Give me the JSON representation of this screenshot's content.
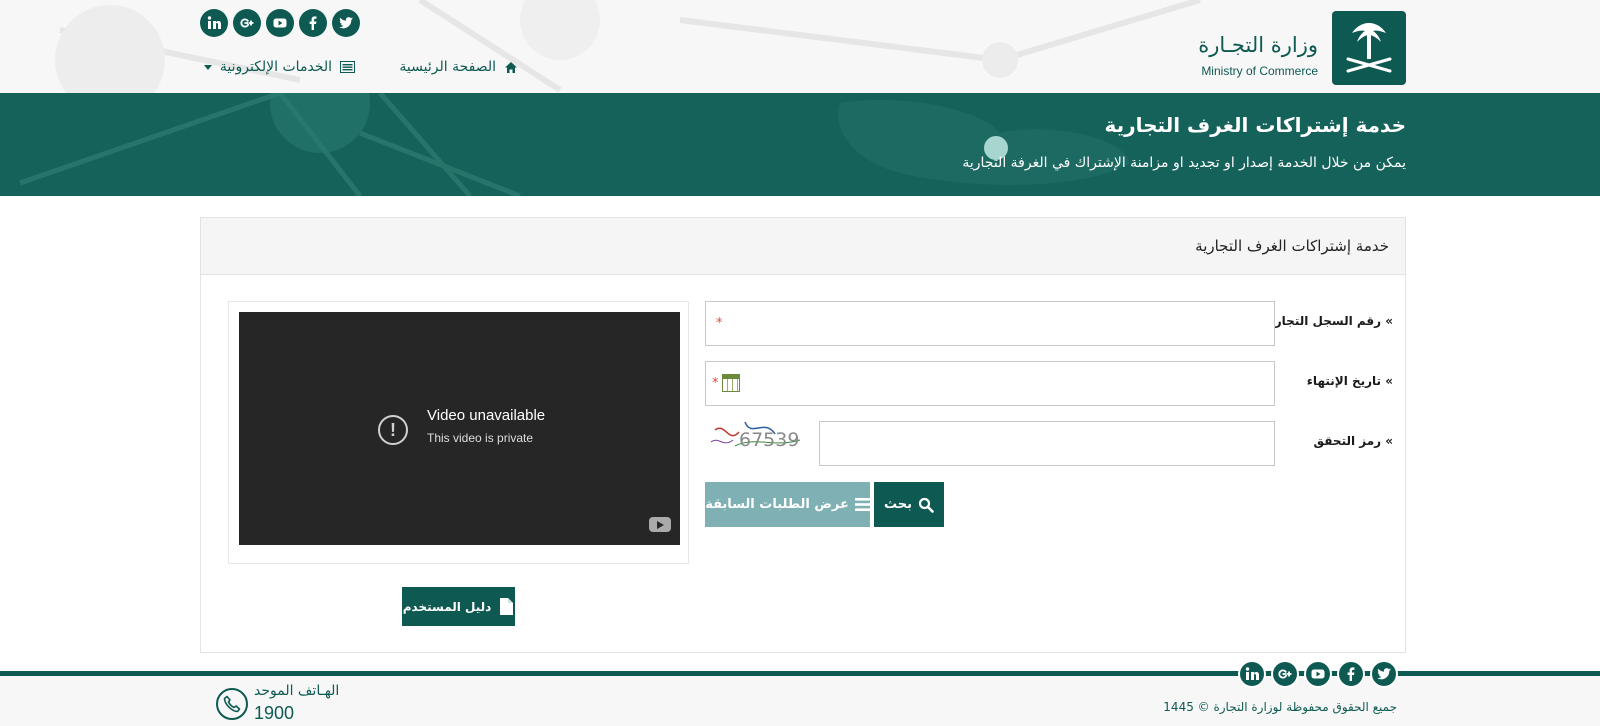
{
  "header": {
    "logo": {
      "arabic": "وزارة التجـارة",
      "english": "Ministry of Commerce"
    },
    "social": [
      "linkedin-icon",
      "google-plus-icon",
      "youtube-icon",
      "facebook-icon",
      "twitter-icon"
    ],
    "nav": {
      "home_label": "الصفحة الرئيسية",
      "services_label": "الخدمات الإلكترونية"
    }
  },
  "banner": {
    "title": "خدمة إشتراكات الغرف التجارية",
    "subtitle": "يمكن من خلال الخدمة إصدار او تجديد او مزامنة الإشتراك في الغرفة التجارية"
  },
  "panel": {
    "title": "خدمة إشتراكات الغرف التجارية",
    "form": {
      "cr_label": "» رقم السجل التجاري",
      "expiry_label": "» تاريخ الإنتهاء",
      "captcha_label": "» رمز التحقق",
      "required_mark": "*",
      "captcha_text": "67539",
      "search_label": "بحث",
      "previous_label": "عرض الطلبات السابقة"
    },
    "video": {
      "title": "Video unavailable",
      "subtitle": "This video is private",
      "alert_glyph": "!"
    },
    "guide_label": "دليل المستخدم"
  },
  "footer": {
    "copyright": "جميع الحقوق محفوظة لوزارة التجارة © 1445",
    "phone_label": "الهـاتف الموحد",
    "phone_number": "1900"
  },
  "colors": {
    "primary": "#0e5a52",
    "banner": "#15625a",
    "secondary_button": "#7fb0b4",
    "required": "#e8453c"
  }
}
